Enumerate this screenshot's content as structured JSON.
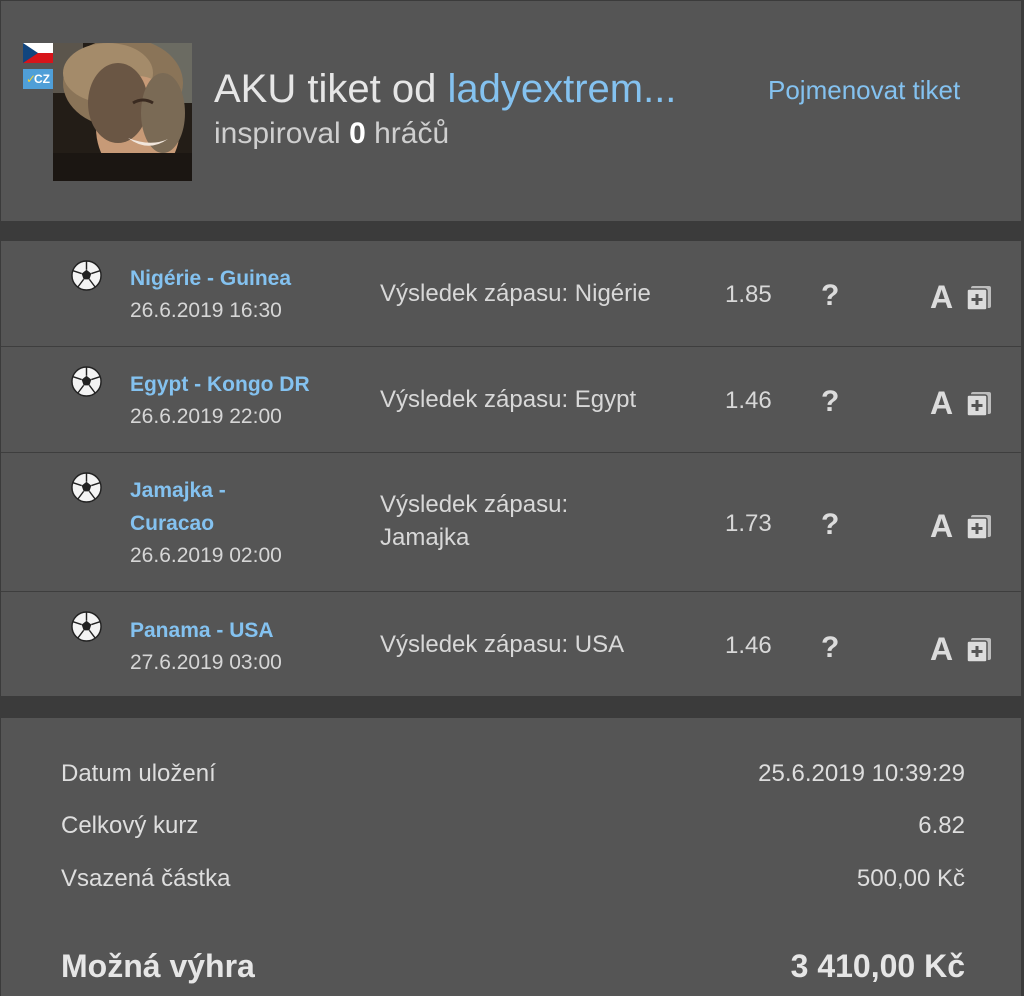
{
  "header": {
    "flag_icon": "czech-flag-icon",
    "country_badge": "CZ",
    "avatar_icon": "user-avatar",
    "title_prefix": "AKU tiket od",
    "username": "ladyextrem...",
    "inspired_prefix": "inspiroval",
    "inspired_count": "0",
    "inspired_suffix": "hráčů",
    "rename_link": "Pojmenovat tiket"
  },
  "bets": [
    {
      "match": "Nigérie - Guinea",
      "datetime": "26.6.2019 16:30",
      "pick": "Výsledek zápasu: Nigérie",
      "odds": "1.85",
      "sport_icon": "soccer-ball-icon"
    },
    {
      "match": "Egypt - Kongo DR",
      "datetime": "26.6.2019 22:00",
      "pick": "Výsledek zápasu: Egypt",
      "odds": "1.46",
      "sport_icon": "soccer-ball-icon"
    },
    {
      "match_line1": "Jamajka -",
      "match_line2": "Curacao",
      "datetime": "26.6.2019 02:00",
      "pick_line1": "Výsledek zápasu:",
      "pick_line2": "Jamajka",
      "odds": "1.73",
      "sport_icon": "soccer-ball-icon"
    },
    {
      "match": "Panama - USA",
      "datetime": "27.6.2019 03:00",
      "pick": "Výsledek zápasu: USA",
      "odds": "1.46",
      "sport_icon": "soccer-ball-icon"
    }
  ],
  "row_icons": {
    "info": "?",
    "analysis": "A"
  },
  "summary": {
    "saved_label": "Datum uložení",
    "saved_value": "25.6.2019 10:39:29",
    "total_odds_label": "Celkový kurz",
    "total_odds_value": "6.82",
    "stake_label": "Vsazená částka",
    "stake_value": "500,00 Kč",
    "win_label": "Možná výhra",
    "win_value": "3 410,00 Kč"
  }
}
